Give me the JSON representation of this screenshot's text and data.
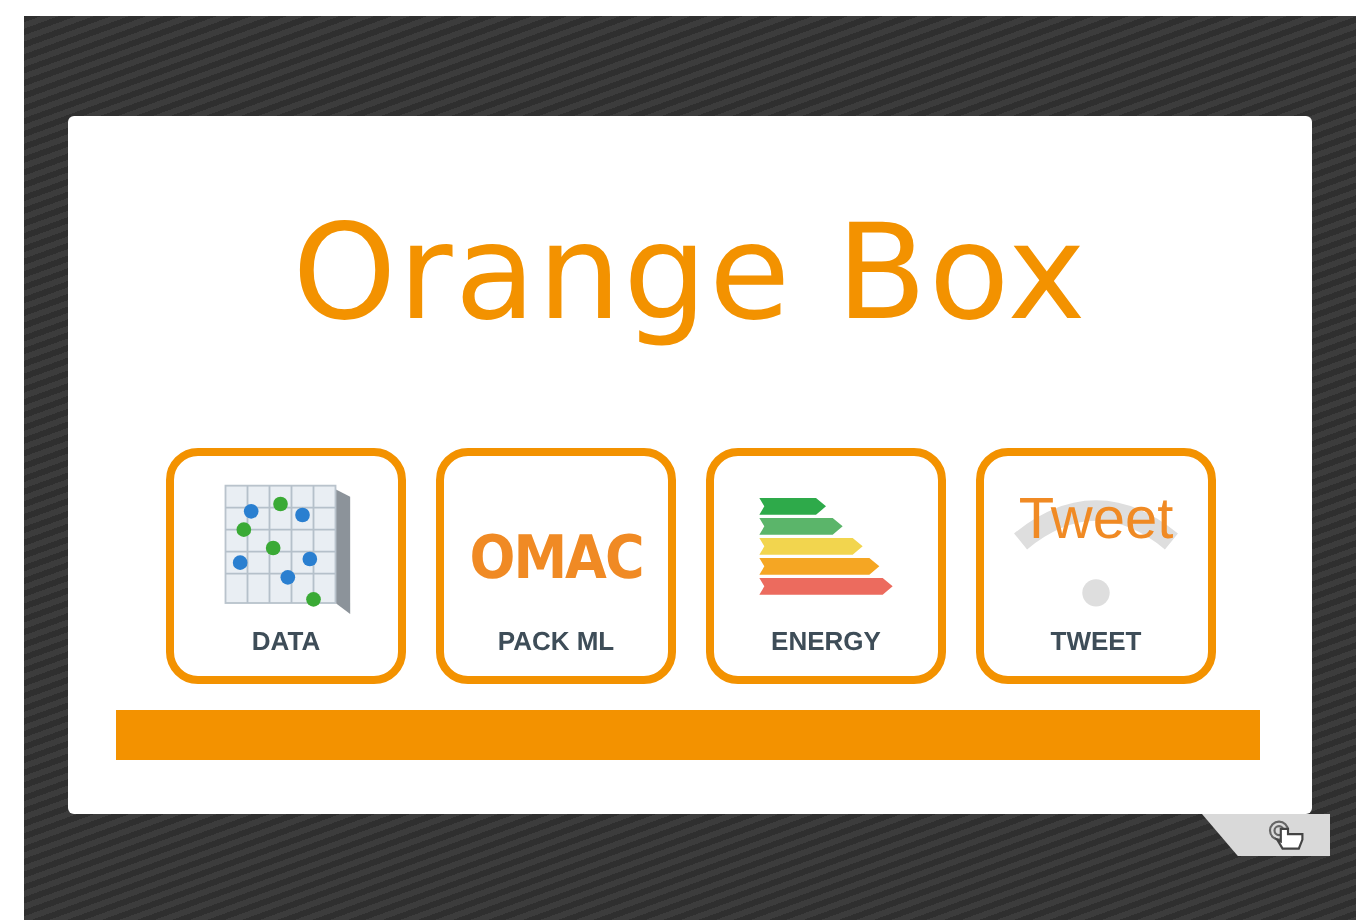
{
  "title": "Orange Box",
  "tiles": [
    {
      "kind": "data",
      "label": "DATA"
    },
    {
      "kind": "logo",
      "logo": "OMAC",
      "label": "PACK ML"
    },
    {
      "kind": "energy",
      "label": "ENERGY"
    },
    {
      "kind": "tweet",
      "logo": "Tweet",
      "label": "TWEET"
    }
  ]
}
